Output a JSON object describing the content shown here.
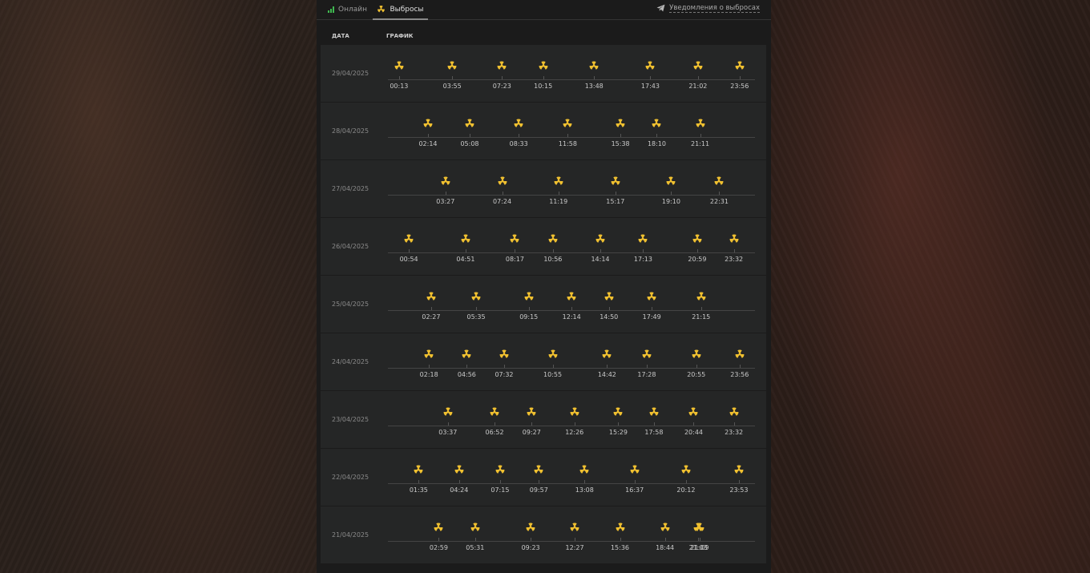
{
  "tabs": {
    "online": "Онлайн",
    "emissions": "Выбросы"
  },
  "notify_label": "Уведомления о выбросах",
  "headers": {
    "date": "ДАТА",
    "chart": "ГРАФИК"
  },
  "accent": "#f0c030",
  "icons": {
    "online": "signal-bars-icon",
    "emissions": "radiation-icon",
    "notify": "telegram-icon"
  },
  "rows": [
    {
      "date": "29/04/2025",
      "times": [
        "00:13",
        "03:55",
        "07:23",
        "10:15",
        "13:48",
        "17:43",
        "21:02",
        "23:56"
      ]
    },
    {
      "date": "28/04/2025",
      "times": [
        "02:14",
        "05:08",
        "08:33",
        "11:58",
        "15:38",
        "18:10",
        "21:11"
      ]
    },
    {
      "date": "27/04/2025",
      "times": [
        "03:27",
        "07:24",
        "11:19",
        "15:17",
        "19:10",
        "22:31"
      ]
    },
    {
      "date": "26/04/2025",
      "times": [
        "00:54",
        "04:51",
        "08:17",
        "10:56",
        "14:14",
        "17:13",
        "20:59",
        "23:32"
      ]
    },
    {
      "date": "25/04/2025",
      "times": [
        "02:27",
        "05:35",
        "09:15",
        "12:14",
        "14:50",
        "17:49",
        "21:15"
      ]
    },
    {
      "date": "24/04/2025",
      "times": [
        "02:18",
        "04:56",
        "07:32",
        "10:55",
        "14:42",
        "17:28",
        "20:55",
        "23:56"
      ]
    },
    {
      "date": "23/04/2025",
      "times": [
        "03:37",
        "06:52",
        "09:27",
        "12:26",
        "15:29",
        "17:58",
        "20:44",
        "23:32"
      ]
    },
    {
      "date": "22/04/2025",
      "times": [
        "01:35",
        "04:24",
        "07:15",
        "09:57",
        "13:08",
        "16:37",
        "20:12",
        "23:53"
      ]
    },
    {
      "date": "21/04/2025",
      "times": [
        "02:59",
        "05:31",
        "09:23",
        "12:27",
        "15:36",
        "18:44",
        "21:09",
        "21:03"
      ]
    }
  ]
}
